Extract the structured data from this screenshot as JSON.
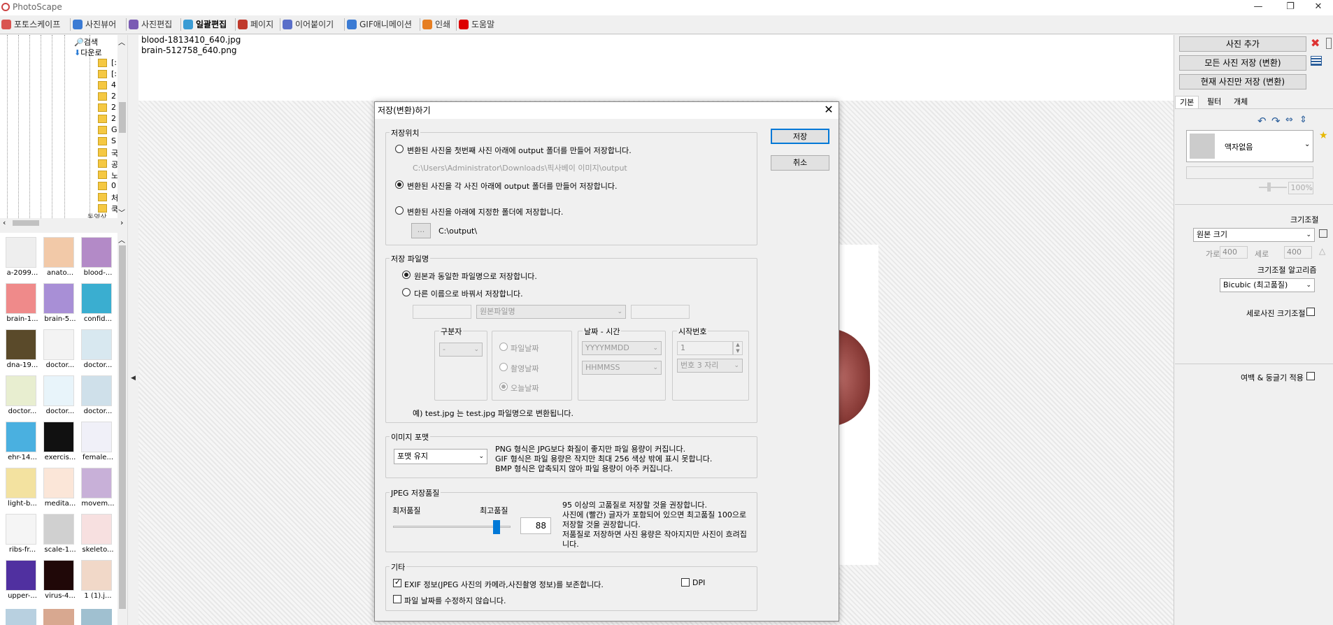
{
  "app": {
    "title": "PhotoScape",
    "min": "—",
    "restore": "❐",
    "close": "✕"
  },
  "tabs": [
    {
      "label": "포토스케이프",
      "color": "#d9534f"
    },
    {
      "label": "사진뷰어",
      "color": "#3b7bd4"
    },
    {
      "label": "사진편집",
      "color": "#7a5bb3"
    },
    {
      "label": "일괄편집",
      "color": "#3b9cd4"
    },
    {
      "label": "페이지",
      "color": "#c0392b"
    },
    {
      "label": "이어붙이기",
      "color": "#5a6fc9"
    },
    {
      "label": "GIF애니메이션",
      "color": "#3b7bd4"
    },
    {
      "label": "인쇄",
      "color": "#e67e22"
    },
    {
      "label": "도움말",
      "color": "#d00"
    }
  ],
  "tree": {
    "search_label": "검색",
    "download_label": "다운로",
    "items": [
      "[:",
      "[:",
      "4",
      "2",
      "2",
      "2",
      "G",
      "S",
      "국",
      "공",
      "노",
      "0",
      "처",
      "쿡"
    ],
    "last_label": "동영상"
  },
  "thumbnails": [
    {
      "label": "a-2099...",
      "color": "#eeeeee"
    },
    {
      "label": "anato...",
      "color": "#f2c9a8"
    },
    {
      "label": "blood-...",
      "color": "#b38ac7"
    },
    {
      "label": "brain-1...",
      "color": "#ef8a8a"
    },
    {
      "label": "brain-5...",
      "color": "#a88fd6"
    },
    {
      "label": "confid...",
      "color": "#3aaed0"
    },
    {
      "label": "dna-19...",
      "color": "#5a4a2a"
    },
    {
      "label": "doctor...",
      "color": "#f3f3f3"
    },
    {
      "label": "doctor...",
      "color": "#d8e8f0"
    },
    {
      "label": "doctor...",
      "color": "#e8eed0"
    },
    {
      "label": "doctor...",
      "color": "#e8f4fa"
    },
    {
      "label": "doctor...",
      "color": "#cfe0ea"
    },
    {
      "label": "ehr-14...",
      "color": "#4ab0e0"
    },
    {
      "label": "exercis...",
      "color": "#111111"
    },
    {
      "label": "female...",
      "color": "#f0f0f8"
    },
    {
      "label": "light-b...",
      "color": "#f3e2a0"
    },
    {
      "label": "medita...",
      "color": "#fbe6d8"
    },
    {
      "label": "movem...",
      "color": "#c8b0d8"
    },
    {
      "label": "ribs-fr...",
      "color": "#f5f5f5"
    },
    {
      "label": "scale-1...",
      "color": "#d0d0d0"
    },
    {
      "label": "skeleto...",
      "color": "#f7e0e0"
    },
    {
      "label": "upper-...",
      "color": "#5030a0"
    },
    {
      "label": "virus-4...",
      "color": "#200808"
    },
    {
      "label": "1 (1).j...",
      "color": "#f1d8c8"
    }
  ],
  "files": [
    "blood-1813410_640.jpg",
    "brain-512758_640.png"
  ],
  "right": {
    "add_photo": "사진 추가",
    "save_all": "모든 사진 저장 (변환)",
    "save_current": "현재 사진만 저장 (변환)",
    "tab_basic": "기본",
    "tab_filter": "필터",
    "tab_object": "개체",
    "frame_value": "액자없음",
    "zoom_value": "100%",
    "resize_label": "크기조절",
    "resize_value": "원본 크기",
    "width_label": "가로",
    "width_value": "400",
    "height_label": "세로",
    "height_value": "400",
    "algo_label": "크기조절 알고리즘",
    "algo_value": "Bicubic (최고품질)",
    "vertical_resize": "세로사진 크기조절",
    "margin_round": "여백 & 둥글기 적용"
  },
  "dialog": {
    "title": "저장(변환)하기",
    "save_button": "저장",
    "cancel_button": "취소",
    "location": {
      "label": "저장위치",
      "opt1": "변환된 사진을 첫번째 사진 아래에 output 폴더를 만들어 저장합니다.",
      "opt1_path": "C:\\Users\\Administrator\\Downloads\\픽사베이 이미지\\output",
      "opt2": "변환된 사진을 각 사진 아래에 output 폴더를 만들어 저장합니다.",
      "opt3": "변환된 사진을 아래에 지정한 폴더에 저장합니다.",
      "browse": "...",
      "folder_path": "C:\\output\\"
    },
    "filename": {
      "label": "저장 파일명",
      "opt_same": "원본과 동일한 파일명으로 저장합니다.",
      "opt_rename": "다른 이름으로 바꿔서 저장합니다.",
      "name_select": "원본파일명",
      "separator_label": "구분자",
      "separator_value": "-",
      "file_date": "파일날짜",
      "shot_date": "촬영날짜",
      "today_date": "오늘날짜",
      "datetime_label": "날짜 - 시간",
      "date_format": "YYYYMMDD",
      "time_format": "HHMMSS",
      "start_num_label": "시작번호",
      "start_num_value": "1",
      "digits_value": "번호 3 자리",
      "example": "예) test.jpg 는 test.jpg  파일명으로 변환됩니다."
    },
    "format": {
      "label": "이미지 포맷",
      "value": "포맷 유지",
      "note1": "PNG 형식은 JPG보다 화질이 좋지만 파일 용량이 커집니다.",
      "note2": "GIF 형식은 파일 용량은 작지만 최대 256 색상 밖에 표시 못합니다.",
      "note3": "BMP 형식은 압축되지 않아 파일 용량이 아주 커집니다."
    },
    "jpeg": {
      "label": "JPEG 저장품질",
      "min_label": "최저품질",
      "max_label": "최고품질",
      "quality": "88",
      "quality_fraction": 0.88,
      "note1": "95 이상의 고품질로 저장할 것을 권장합니다.",
      "note2": "사진에 (빨간) 글자가 포함되어 있으면 최고품질 100으로",
      "note3": "저장할 것을 권장합니다.",
      "note4": "저품질로 저장하면 사진 용량은 작아지지만 사진이 흐려집",
      "note5": "니다."
    },
    "misc": {
      "label": "기타",
      "exif": "EXIF 정보(JPEG 사진의 카메라,사진촬영 정보)를 보존합니다.",
      "dpi": "DPI",
      "keep_date": "파일 날짜를 수정하지 않습니다."
    }
  }
}
